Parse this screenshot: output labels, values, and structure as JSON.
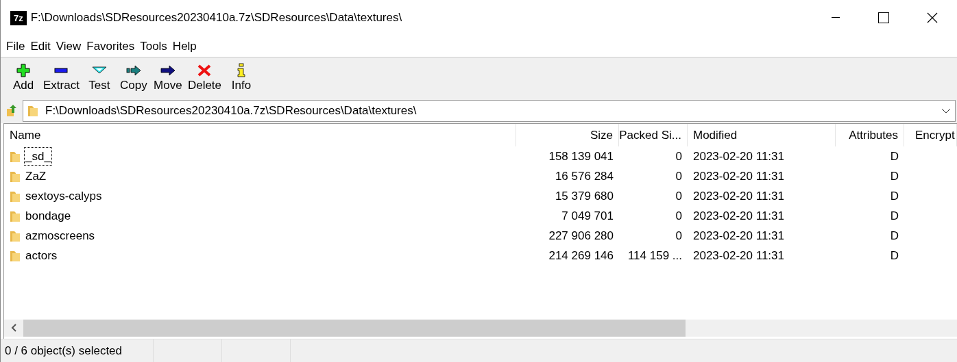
{
  "window": {
    "logo": "7z",
    "title": "F:\\Downloads\\SDResources20230410a.7z\\SDResources\\Data\\textures\\"
  },
  "menu": [
    "File",
    "Edit",
    "View",
    "Favorites",
    "Tools",
    "Help"
  ],
  "toolbar": [
    {
      "kind": "add",
      "label": "Add"
    },
    {
      "kind": "extract",
      "label": "Extract"
    },
    {
      "kind": "test",
      "label": "Test"
    },
    {
      "kind": "copy",
      "label": "Copy"
    },
    {
      "kind": "move",
      "label": "Move"
    },
    {
      "kind": "delete",
      "label": "Delete"
    },
    {
      "kind": "info",
      "label": "Info"
    }
  ],
  "address": {
    "value": "F:\\Downloads\\SDResources20230410a.7z\\SDResources\\Data\\textures\\"
  },
  "table": {
    "columns": [
      "Name",
      "Size",
      "Packed Si...",
      "Modified",
      "Attributes",
      "Encrypt"
    ],
    "rows": [
      {
        "name": "_sd_",
        "size": "158 139 041",
        "packed": "0",
        "modified": "2023-02-20 11:31",
        "attributes": "D",
        "focused": true
      },
      {
        "name": "ZaZ",
        "size": "16 576 284",
        "packed": "0",
        "modified": "2023-02-20 11:31",
        "attributes": "D",
        "focused": false
      },
      {
        "name": "sextoys-calyps",
        "size": "15 379 680",
        "packed": "0",
        "modified": "2023-02-20 11:31",
        "attributes": "D",
        "focused": false
      },
      {
        "name": "bondage",
        "size": "7 049 701",
        "packed": "0",
        "modified": "2023-02-20 11:31",
        "attributes": "D",
        "focused": false
      },
      {
        "name": "azmoscreens",
        "size": "227 906 280",
        "packed": "0",
        "modified": "2023-02-20 11:31",
        "attributes": "D",
        "focused": false
      },
      {
        "name": "actors",
        "size": "214 269 146",
        "packed": "114 159 ...",
        "modified": "2023-02-20 11:31",
        "attributes": "D",
        "focused": false
      }
    ]
  },
  "status_bar": {
    "text": "0 / 6 object(s) selected"
  }
}
